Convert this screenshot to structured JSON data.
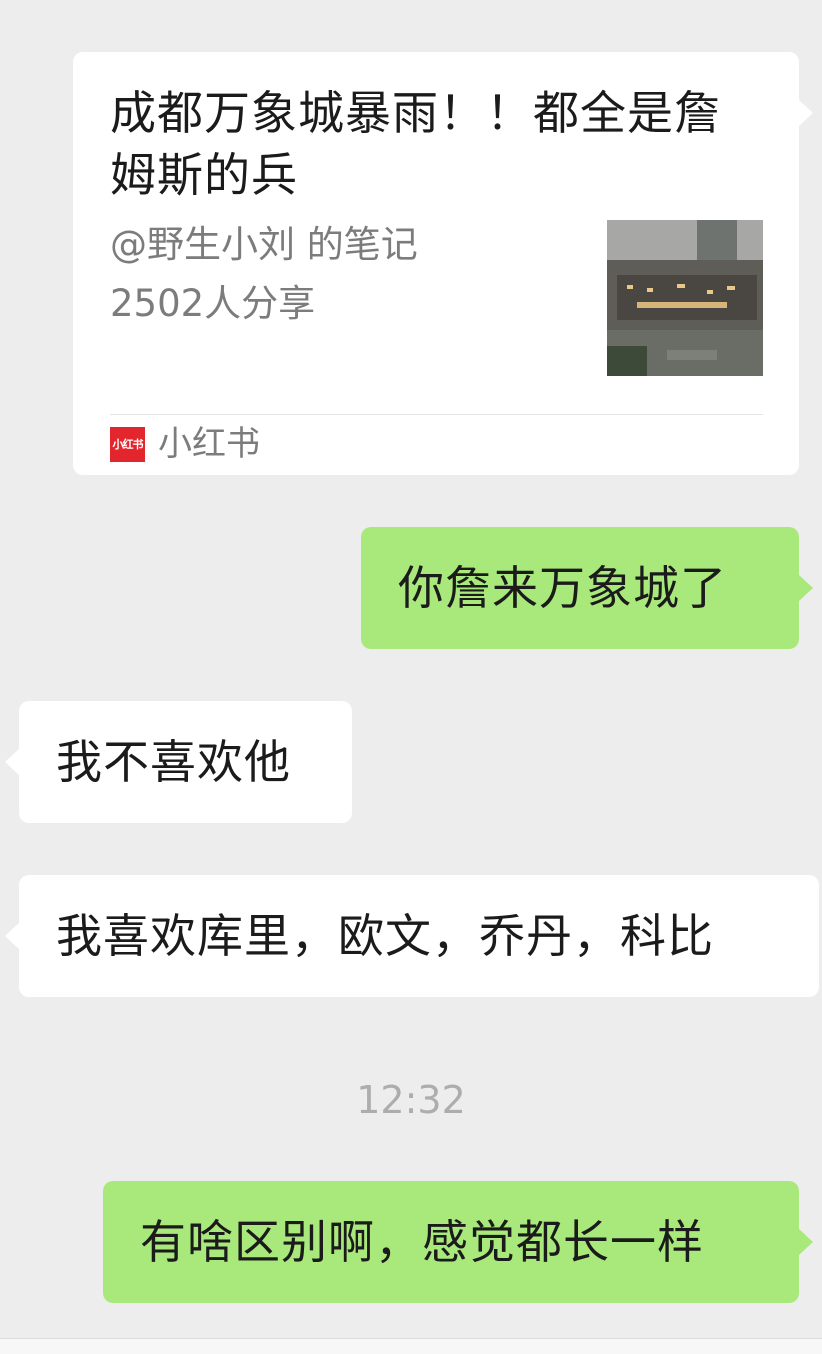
{
  "messages": {
    "card": {
      "title": "成都万象城暴雨！！都全是詹姆斯的兵",
      "author": "@野生小刘 的笔记",
      "shares": "2502人分享",
      "source_logo_text": "小红书",
      "source_name": "小红书"
    },
    "msg1": "你詹来万象城了",
    "msg2": "我不喜欢他",
    "msg3": "我喜欢库里，欧文，乔丹，科比",
    "timestamp": "12:32",
    "msg4": "有啥区别啊，感觉都长一样"
  },
  "colors": {
    "background": "#ededed",
    "bubble_self": "#a9e97b",
    "bubble_other": "#ffffff",
    "source_logo": "#e3262e"
  }
}
